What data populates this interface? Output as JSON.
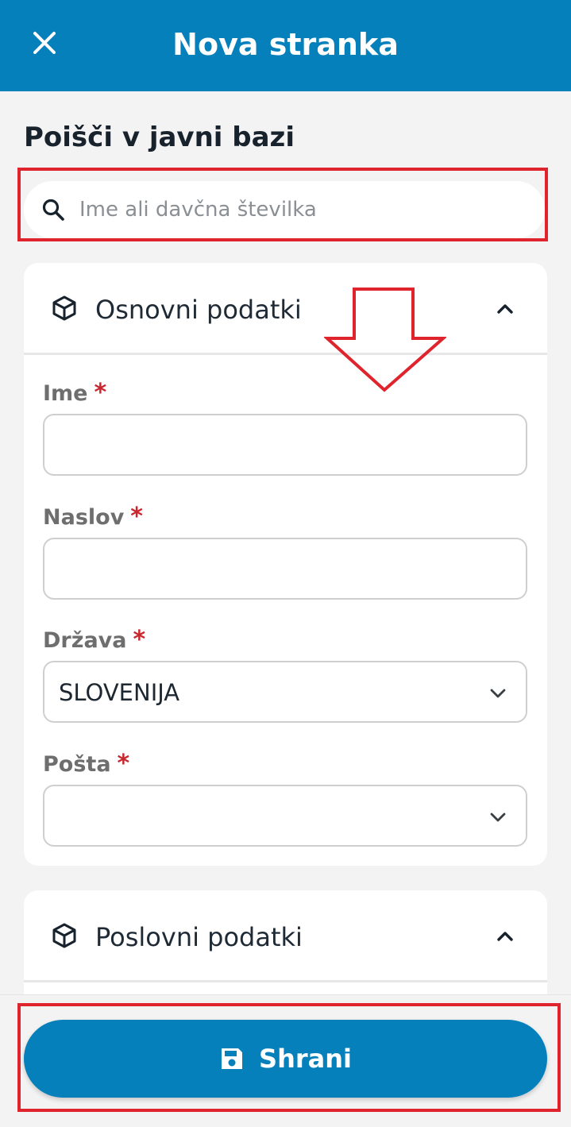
{
  "header": {
    "title": "Nova stranka",
    "close_icon": "close-icon",
    "background": "#0580bb"
  },
  "search": {
    "heading": "Poišči v javni bazi",
    "placeholder": "Ime ali davčna številka",
    "value": ""
  },
  "basic_section": {
    "title": "Osnovni podatki",
    "icon": "cube-icon",
    "toggle_icon": "chevron-up-icon",
    "fields": {
      "name": {
        "label": "Ime",
        "required_mark": "*",
        "value": ""
      },
      "address": {
        "label": "Naslov",
        "required_mark": "*",
        "value": ""
      },
      "country": {
        "label": "Država",
        "required_mark": "*",
        "value": "SLOVENIJA"
      },
      "post": {
        "label": "Pošta",
        "required_mark": "*",
        "value": ""
      }
    }
  },
  "business_section": {
    "title": "Poslovni podatki",
    "icon": "cube-icon",
    "toggle_icon": "chevron-up-icon"
  },
  "footer": {
    "save_label": "Shrani",
    "save_icon": "floppy-disk-icon"
  },
  "colors": {
    "accent": "#0580bb",
    "required": "#c9262e",
    "highlight": "#e0242d"
  }
}
